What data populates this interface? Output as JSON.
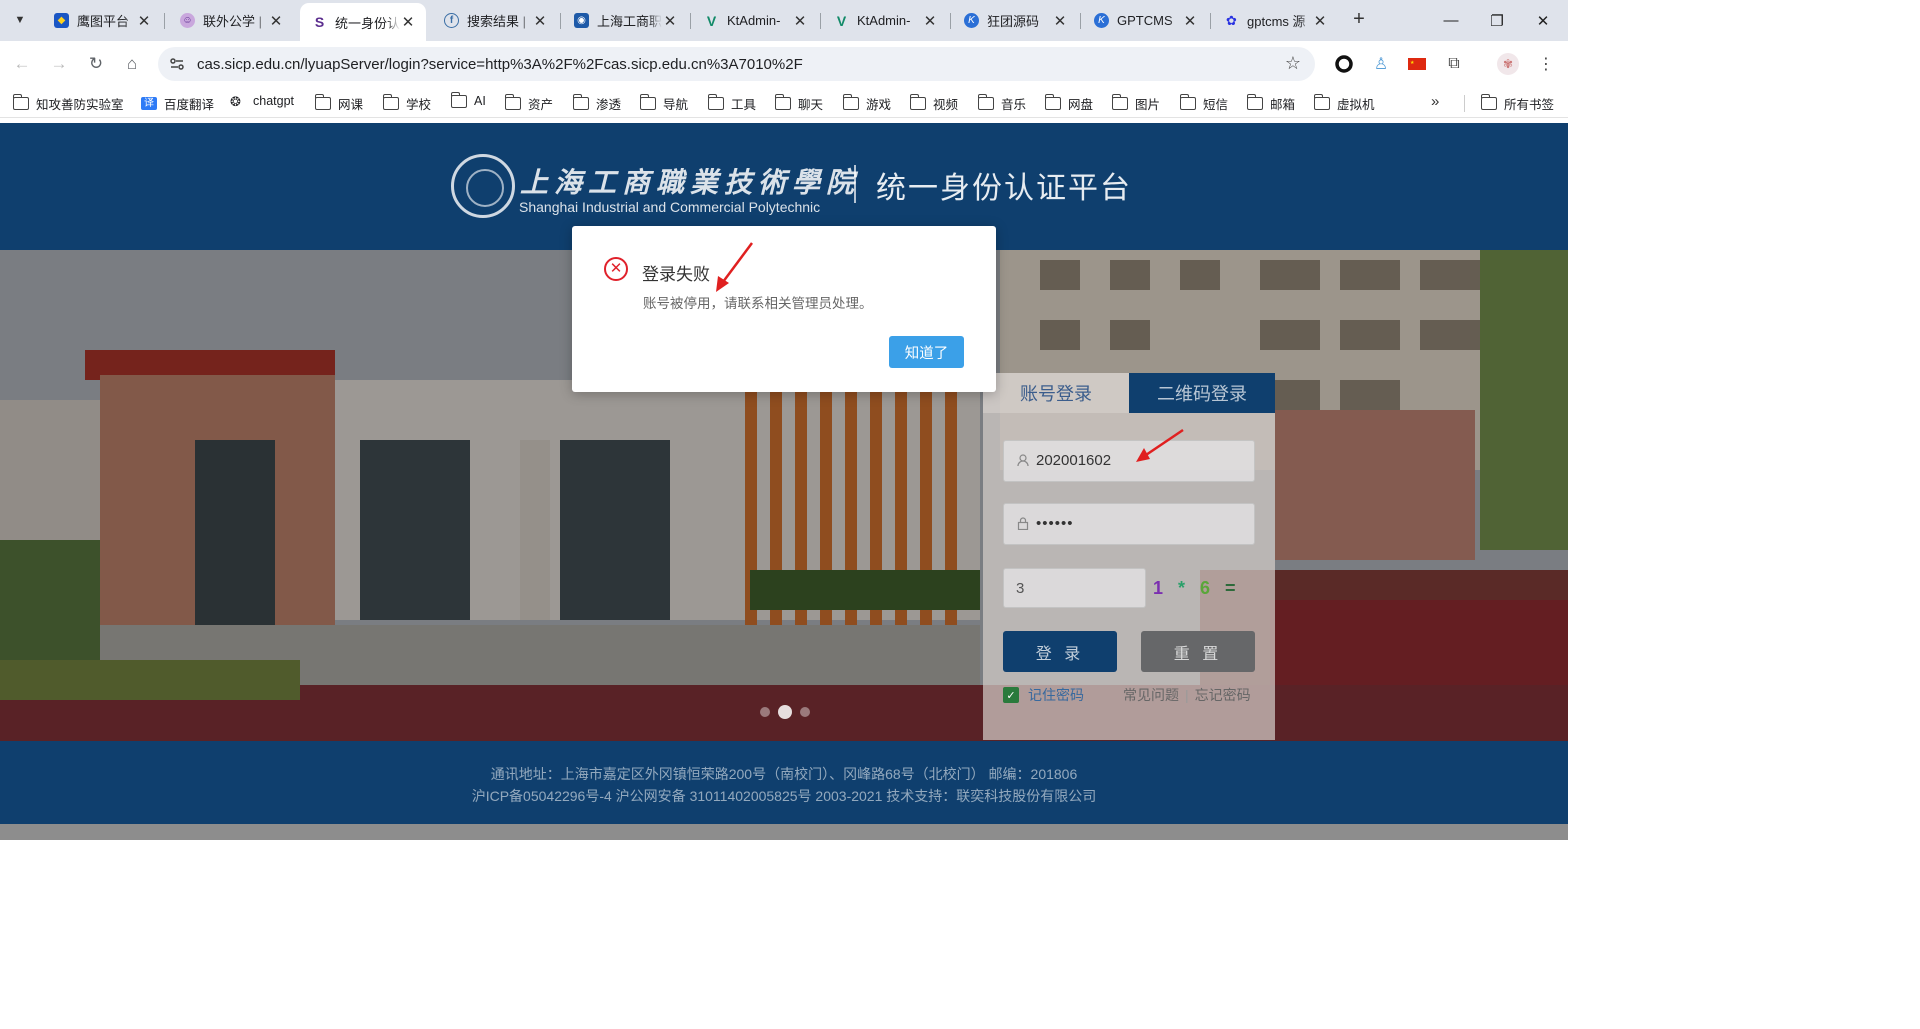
{
  "browser": {
    "tabs": [
      {
        "title": "鹰图平台",
        "favicon": "eagle-icon",
        "color": "#1a56c4"
      },
      {
        "title": "联外公学 |",
        "favicon": "avatar-icon",
        "color": "#8e44ad"
      },
      {
        "title": "统一身份认",
        "favicon": "spiral-icon",
        "color": "#5b2d8e",
        "active": true
      },
      {
        "title": "搜索结果 |",
        "favicon": "f-icon",
        "color": "#3a6ea5"
      },
      {
        "title": "上海工商职",
        "favicon": "camera-icon",
        "color": "#1e5aa8"
      },
      {
        "title": "KtAdmin-",
        "favicon": "v-icon",
        "color": "#128a68"
      },
      {
        "title": "KtAdmin-",
        "favicon": "v-icon",
        "color": "#128a68"
      },
      {
        "title": "狂团源码",
        "favicon": "k-icon",
        "color": "#2b6fd6"
      },
      {
        "title": "GPTCMS",
        "favicon": "k-icon",
        "color": "#2b6fd6"
      },
      {
        "title": "gptcms 源",
        "favicon": "paw-icon",
        "color": "#2932e1"
      }
    ],
    "url": "cas.sicp.edu.cn/lyuapServer/login?service=http%3A%2F%2Fcas.sicp.edu.cn%3A7010%2F",
    "bookmarks": [
      {
        "label": "知攻善防实验室",
        "icon": "folder-icon"
      },
      {
        "label": "百度翻译",
        "icon": "translate-icon"
      },
      {
        "label": "chatgpt",
        "icon": "openai-icon"
      },
      {
        "label": "网课",
        "icon": "folder-icon"
      },
      {
        "label": "学校",
        "icon": "folder-icon"
      },
      {
        "label": "AI",
        "icon": "folder-icon"
      },
      {
        "label": "资产",
        "icon": "folder-icon"
      },
      {
        "label": "渗透",
        "icon": "folder-icon"
      },
      {
        "label": "导航",
        "icon": "folder-icon"
      },
      {
        "label": "工具",
        "icon": "folder-icon"
      },
      {
        "label": "聊天",
        "icon": "folder-icon"
      },
      {
        "label": "游戏",
        "icon": "folder-icon"
      },
      {
        "label": "视频",
        "icon": "folder-icon"
      },
      {
        "label": "音乐",
        "icon": "folder-icon"
      },
      {
        "label": "网盘",
        "icon": "folder-icon"
      },
      {
        "label": "图片",
        "icon": "folder-icon"
      },
      {
        "label": "短信",
        "icon": "folder-icon"
      },
      {
        "label": "邮箱",
        "icon": "folder-icon"
      },
      {
        "label": "虚拟机",
        "icon": "folder-icon"
      }
    ],
    "bookmarks_more": "»",
    "all_bookmarks": "所有书签"
  },
  "header": {
    "school_cn": "上海工商職業技術學院",
    "school_en": "Shanghai Industrial and Commercial Polytechnic",
    "platform": "统一身份认证平台"
  },
  "login": {
    "tab_account": "账号登录",
    "tab_qr": "二维码登录",
    "username": "202001602",
    "password": "••••••",
    "captcha_input": "3",
    "captcha": [
      "1",
      "*",
      "6",
      "="
    ],
    "captcha_colors": [
      "#7b2fb0",
      "#2aa06a",
      "#5aa63a",
      "#2d6a3a"
    ],
    "login_button": "登 录",
    "reset_button": "重 置",
    "remember": "记住密码",
    "faq": "常见问题",
    "forgot": "忘记密码"
  },
  "footer": {
    "line1": "通讯地址：上海市嘉定区外冈镇恒荣路200号（南校门）、冈峰路68号（北校门） 邮编：201806",
    "line2": "沪ICP备05042296号-4 沪公网安备 31011402005825号 2003-2021 技术支持：联奕科技股份有限公司"
  },
  "modal": {
    "title": "登录失败",
    "message": "账号被停用，请联系相关管理员处理。",
    "button": "知道了",
    "icon": "error-circle-icon"
  },
  "colors": {
    "brand_navy": "#0f3f6e",
    "modal_button": "#3ba0e8",
    "error_red": "#e0212b",
    "annotation_red": "#e02020"
  }
}
